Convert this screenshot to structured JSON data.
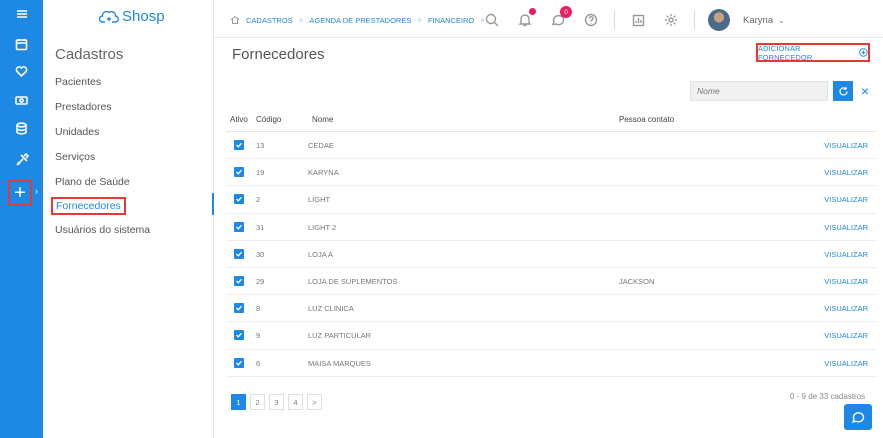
{
  "brand": {
    "name": "Shosp"
  },
  "sidebar": {
    "title": "Cadastros",
    "items": [
      {
        "label": "Pacientes"
      },
      {
        "label": "Prestadores"
      },
      {
        "label": "Unidades"
      },
      {
        "label": "Serviços"
      },
      {
        "label": "Plano de Saúde"
      },
      {
        "label": "Fornecedores",
        "active": true
      },
      {
        "label": "Usuários do sistema"
      }
    ]
  },
  "rail": {
    "icons": [
      "menu-icon",
      "calendar-icon",
      "heart-icon",
      "money-icon",
      "database-icon",
      "tools-icon"
    ],
    "plus": "+"
  },
  "tabs": [
    {
      "label": "CADASTROS"
    },
    {
      "label": "AGENDA DE PRESTADORES"
    },
    {
      "label": "FINANCEIRO"
    }
  ],
  "header": {
    "notification_count": "0",
    "user": "Karyna"
  },
  "page": {
    "title": "Fornecedores",
    "add_button": "ADICIONAR FORNECEDOR",
    "search_placeholder": "Nome"
  },
  "table": {
    "columns": [
      "Ativo",
      "Código",
      "Nome",
      "Pessoa contato"
    ],
    "action_label": "VISUALIZAR",
    "rows": [
      {
        "code": "13",
        "name": "CEDAE",
        "contact": ""
      },
      {
        "code": "19",
        "name": "KARYNA",
        "contact": ""
      },
      {
        "code": "2",
        "name": "LIGHT",
        "contact": ""
      },
      {
        "code": "31",
        "name": "LIGHT 2",
        "contact": ""
      },
      {
        "code": "30",
        "name": "LOJA A",
        "contact": ""
      },
      {
        "code": "29",
        "name": "LOJA DE SUPLEMENTOS",
        "contact": "JACKSON"
      },
      {
        "code": "8",
        "name": "LUZ CLINICA",
        "contact": ""
      },
      {
        "code": "9",
        "name": "LUZ PARTICULAR",
        "contact": ""
      },
      {
        "code": "6",
        "name": "MAISA MARQUES",
        "contact": ""
      }
    ]
  },
  "pagination": {
    "pages": [
      "1",
      "2",
      "3",
      "4",
      ">"
    ],
    "current": "1",
    "summary": "0 - 9 de 33 cadastros"
  },
  "colors": {
    "primary": "#1e88e5",
    "highlight": "#e53935",
    "badge": "#e91e63"
  }
}
